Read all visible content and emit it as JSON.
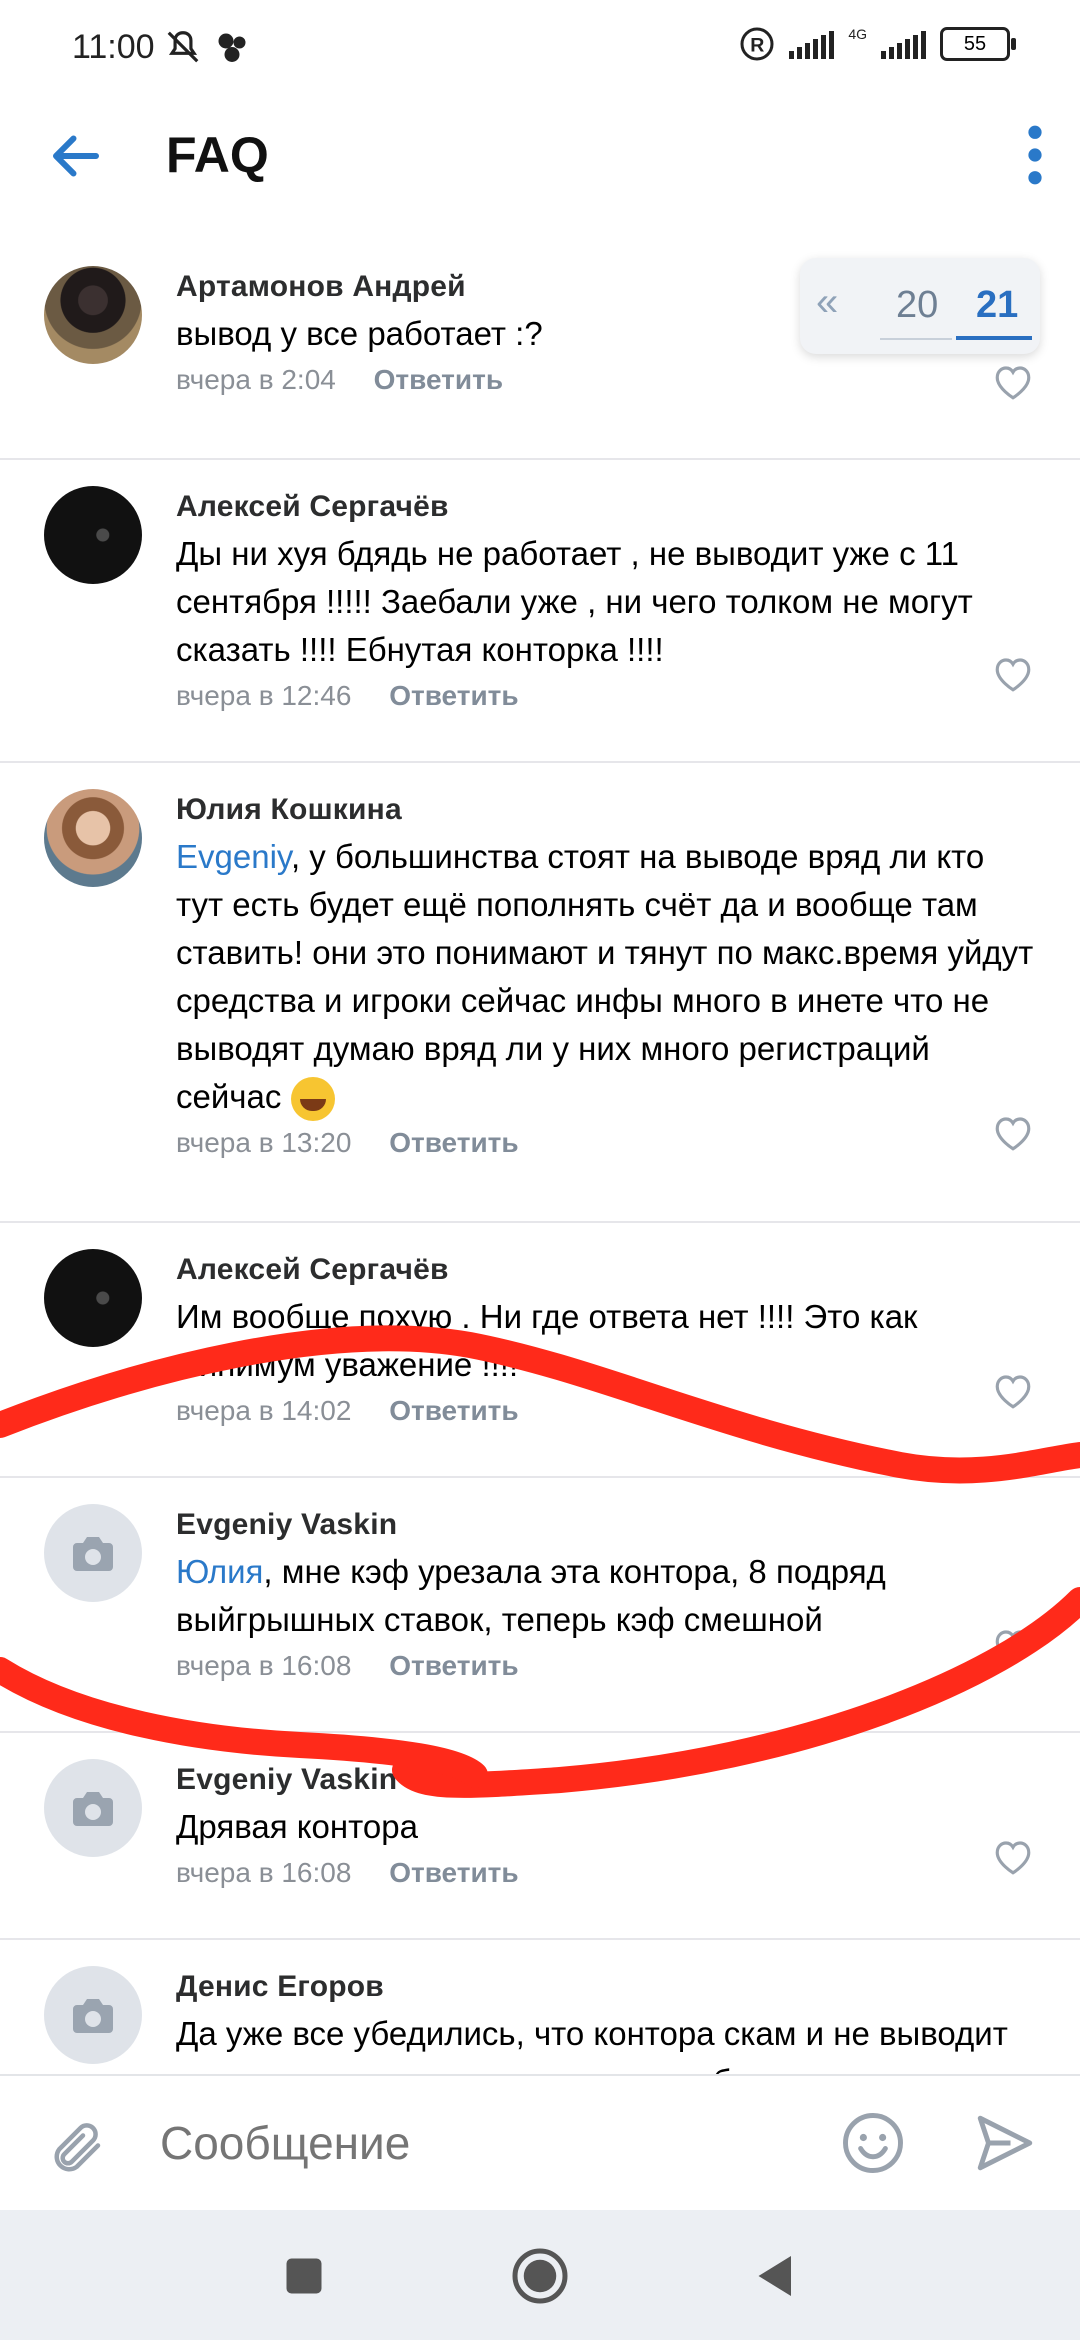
{
  "status_bar": {
    "time": "11:00",
    "network": "4G",
    "battery": "55"
  },
  "header": {
    "title": "FAQ"
  },
  "pagination": {
    "prev": "«",
    "pages": [
      "20",
      "21"
    ],
    "active": "21"
  },
  "comments": [
    {
      "author": "Артамонов Андрей",
      "text": "вывод у все работает :?",
      "time": "вчера в 2:04",
      "reply": "Ответить"
    },
    {
      "author": "Алексей Сергачёв",
      "text": "Ды ни хуя бдядь не работает , не выводит уже с 11 сентября !!!!! Заебали уже , ни чего толком не могут сказать !!!! Ебнутая конторка !!!!",
      "time": "вчера в 12:46",
      "reply": "Ответить"
    },
    {
      "author": "Юлия Кошкина",
      "mention": "Evgeniy",
      "text": ", у большинства стоят на выводе вряд ли кто тут есть будет ещё пополнять счёт да и вообще там ставить! они это понимают и тянут по макс.время уйдут средства и игроки сейчас инфы много в инете что не выводят думаю вряд ли у них много регистраций сейчас",
      "time": "вчера в 13:20",
      "reply": "Ответить"
    },
    {
      "author": "Алексей Сергачёв",
      "text": "Им вообще похую . Ни где ответа нет !!!! Это как минимум уважение !!!!",
      "time": "вчера в 14:02",
      "reply": "Ответить"
    },
    {
      "author": "Evgeniy Vaskin",
      "mention": "Юлия",
      "text": ",  мне кэф урезала эта контора, 8 подряд выйгрышных ставок, теперь кэф смешной",
      "time": "вчера в 16:08",
      "reply": "Ответить"
    },
    {
      "author": "Evgeniy Vaskin",
      "text": "Дрявая контора",
      "time": "вчера в 16:08",
      "reply": "Ответить"
    },
    {
      "author": "Денис Егоров",
      "text": "Да уже все убедились, что контора скам и не выводит деньги, думаю в скором времени обьявят",
      "time": "",
      "reply": ""
    }
  ],
  "composer": {
    "placeholder": "Сообщение"
  },
  "colors": {
    "accent": "#2a79c9",
    "annotation": "#ff2a1a"
  }
}
